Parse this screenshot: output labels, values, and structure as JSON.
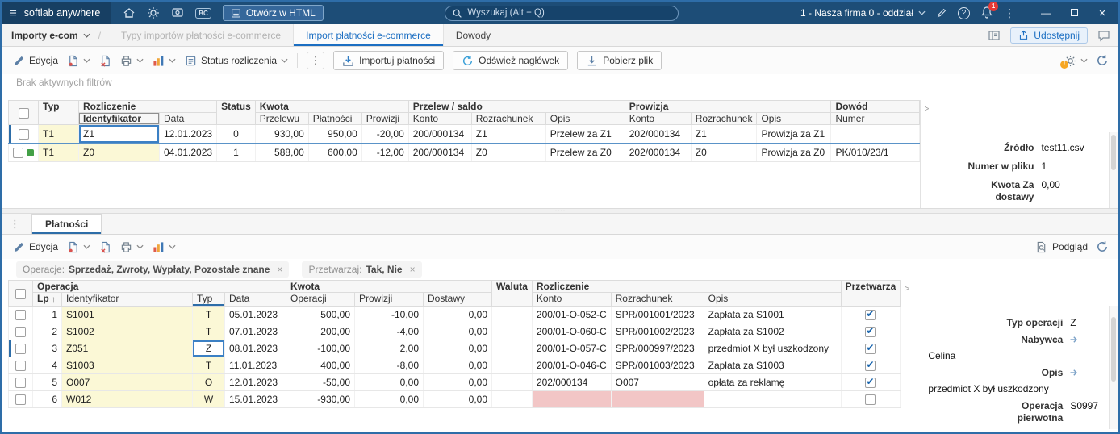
{
  "icons": {
    "hamburger": "≡",
    "kebab": "⋮",
    "min": "—",
    "close": "×",
    "question": "?",
    "check": "✔",
    "sort_up": "↑",
    "expander": ">",
    "dots": "····",
    "chip_close": "×",
    "warning": "!"
  },
  "titlebar": {
    "app_name": "softlab anywhere",
    "bc_badge": "BC",
    "open_html_label": "Otwórz w HTML",
    "search_placeholder": "Wyszukaj (Alt + Q)",
    "company_selector": "1 - Nasza firma 0 - oddział",
    "notification_count": "1"
  },
  "nav": {
    "module_label": "Importy e-com",
    "separator": "/",
    "tab_types": "Typy importów płatności e-commerce",
    "tab_import": "Import płatności e-commerce",
    "tab_dowody": "Dowody",
    "share_label": "Udostępnij"
  },
  "toolbar": {
    "edit_label": "Edycja",
    "status_label": "Status rozliczenia",
    "import_label": "Importuj płatności",
    "refresh_label": "Odśwież nagłówek",
    "download_label": "Pobierz plik"
  },
  "filters_note": "Brak aktywnych filtrów",
  "upper_grid": {
    "groups": {
      "typ": "Typ",
      "rozliczenie": "Rozliczenie",
      "status": "Status",
      "kwota": "Kwota",
      "przelew_saldo": "Przelew / saldo",
      "prowizja": "Prowizja",
      "dowod": "Dowód"
    },
    "cols": {
      "identyfikator": "Identyfikator",
      "data": "Data",
      "przelewu": "Przelewu",
      "platnosci": "Płatności",
      "prowizji": "Prowizji",
      "konto": "Konto",
      "rozrachunek": "Rozrachunek",
      "opis": "Opis",
      "numer": "Numer"
    },
    "rows": [
      {
        "typ": "T1",
        "identyfikator": "Z1",
        "data": "12.01.2023",
        "status": "0",
        "przelewu": "930,00",
        "platnosci": "950,00",
        "prowizji": "-20,00",
        "ps_konto": "200/000134",
        "ps_rozrachunek": "Z1",
        "ps_opis": "Przelew za Z1",
        "pr_konto": "202/000134",
        "pr_rozrachunek": "Z1",
        "pr_opis": "Prowizja za Z1",
        "dowod_numer": "",
        "selected": true
      },
      {
        "typ": "T1",
        "identyfikator": "Z0",
        "data": "04.01.2023",
        "status": "1",
        "przelewu": "588,00",
        "platnosci": "600,00",
        "prowizji": "-12,00",
        "ps_konto": "200/000134",
        "ps_rozrachunek": "Z0",
        "ps_opis": "Przelew za Z0",
        "pr_konto": "202/000134",
        "pr_rozrachunek": "Z0",
        "pr_opis": "Prowizja za Z0",
        "dowod_numer": "PK/010/23/1",
        "status_ok": true
      }
    ]
  },
  "upper_detail": {
    "rows": [
      {
        "label": "Źródło",
        "value": "test11.csv"
      },
      {
        "label": "Numer w pliku",
        "value": "1"
      },
      {
        "label": "Kwota Za dostawy",
        "value": "0,00"
      }
    ]
  },
  "lower": {
    "tab_label": "Płatności",
    "toolbar": {
      "edit_label": "Edycja",
      "preview_label": "Podgląd"
    },
    "filters": [
      {
        "label": "Operacje:",
        "value": "Sprzedaż, Zwroty, Wypłaty, Pozostałe znane"
      },
      {
        "label": "Przetwarzaj:",
        "value": "Tak, Nie"
      }
    ],
    "grid": {
      "groups": {
        "operacja": "Operacja",
        "kwota": "Kwota",
        "waluta": "Waluta",
        "rozliczenie": "Rozliczenie",
        "przetwarzaj": "Przetwarza"
      },
      "cols": {
        "lp": "Lp",
        "identyfikator": "Identyfikator",
        "typ": "Typ",
        "data": "Data",
        "operacji": "Operacji",
        "prowizji": "Prowizji",
        "dostawy": "Dostawy",
        "konto": "Konto",
        "rozrachunek": "Rozrachunek",
        "opis": "Opis"
      },
      "rows": [
        {
          "lp": "1",
          "identyfikator": "S1001",
          "typ": "T",
          "data": "05.01.2023",
          "operacji": "500,00",
          "prowizji": "-10,00",
          "dostawy": "0,00",
          "waluta": "",
          "konto": "200/01-O-052-C",
          "rozrachunek": "SPR/001001/2023",
          "opis": "Zapłata za S1001",
          "przetwarzaj": true
        },
        {
          "lp": "2",
          "identyfikator": "S1002",
          "typ": "T",
          "data": "07.01.2023",
          "operacji": "200,00",
          "prowizji": "-4,00",
          "dostawy": "0,00",
          "waluta": "",
          "konto": "200/01-O-060-C",
          "rozrachunek": "SPR/001002/2023",
          "opis": "Zapłata za S1002",
          "przetwarzaj": true
        },
        {
          "lp": "3",
          "identyfikator": "Z051",
          "typ": "Z",
          "data": "08.01.2023",
          "operacji": "-100,00",
          "prowizji": "2,00",
          "dostawy": "0,00",
          "waluta": "",
          "konto": "200/01-O-057-C",
          "rozrachunek": "SPR/000997/2023",
          "opis": "przedmiot X był uszkodzony",
          "przetwarzaj": true,
          "selected": true
        },
        {
          "lp": "4",
          "identyfikator": "S1003",
          "typ": "T",
          "data": "11.01.2023",
          "operacji": "400,00",
          "prowizji": "-8,00",
          "dostawy": "0,00",
          "waluta": "",
          "konto": "200/01-O-046-C",
          "rozrachunek": "SPR/001003/2023",
          "opis": "Zapłata za S1003",
          "przetwarzaj": true
        },
        {
          "lp": "5",
          "identyfikator": "O007",
          "typ": "O",
          "data": "12.01.2023",
          "operacji": "-50,00",
          "prowizji": "0,00",
          "dostawy": "0,00",
          "waluta": "",
          "konto": "202/000134",
          "rozrachunek": "O007",
          "opis": "opłata za reklamę",
          "przetwarzaj": true
        },
        {
          "lp": "6",
          "identyfikator": "W012",
          "typ": "W",
          "data": "15.01.2023",
          "operacji": "-930,00",
          "prowizji": "0,00",
          "dostawy": "0,00",
          "waluta": "",
          "konto": "",
          "rozrachunek": "",
          "opis": "",
          "przetwarzaj": false,
          "invalid": true
        }
      ]
    },
    "detail": {
      "rows": [
        {
          "label": "Typ operacji",
          "value": "Z"
        },
        {
          "label": "Nabywca",
          "value": "Celina",
          "link": true
        },
        {
          "label": "Opis",
          "value": "przedmiot X był uszkodzony",
          "link": true
        },
        {
          "label": "Operacja pierwotna",
          "value": "S0997"
        }
      ]
    }
  }
}
